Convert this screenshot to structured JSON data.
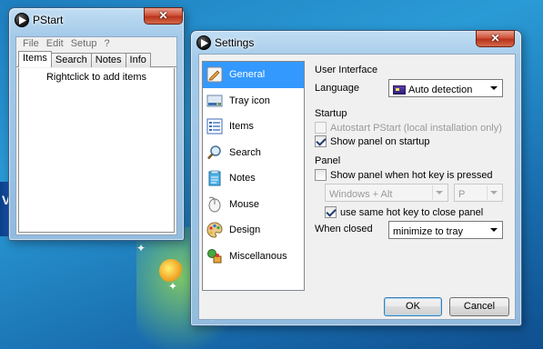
{
  "pstart": {
    "title": "PStart",
    "close_glyph": "✕",
    "menu": [
      "File",
      "Edit",
      "Setup",
      "?"
    ],
    "tabs": [
      "Items",
      "Search",
      "Notes",
      "Info"
    ],
    "active_tab": "Items",
    "hint": "Rightclick to add items"
  },
  "settings": {
    "title": "Settings",
    "close_glyph": "✕",
    "nav": [
      {
        "label": "General",
        "icon": "general-icon",
        "active": true
      },
      {
        "label": "Tray icon",
        "icon": "tray-icon"
      },
      {
        "label": "Items",
        "icon": "items-icon"
      },
      {
        "label": "Search",
        "icon": "search-icon"
      },
      {
        "label": "Notes",
        "icon": "notes-icon"
      },
      {
        "label": "Mouse",
        "icon": "mouse-icon"
      },
      {
        "label": "Design",
        "icon": "palette-icon"
      },
      {
        "label": "Miscellanous",
        "icon": "misc-icon"
      }
    ],
    "ui_group": {
      "title": "User Interface",
      "language_label": "Language",
      "language_value": "Auto detection"
    },
    "startup_group": {
      "title": "Startup",
      "autostart_label": "Autostart PStart (local installation only)",
      "show_panel_label": "Show panel on startup"
    },
    "panel_group": {
      "title": "Panel",
      "hotkey_label": "Show panel when hot key is pressed",
      "modifier_value": "Windows + Alt",
      "key_value": "P",
      "same_hotkey_label": "use same hot key to close panel",
      "when_closed_label": "When closed",
      "when_closed_value": "minimize to tray"
    },
    "ok_label": "OK",
    "cancel_label": "Cancel"
  },
  "colors": {
    "selection": "#3399ff",
    "close_button": "#c8412a"
  }
}
